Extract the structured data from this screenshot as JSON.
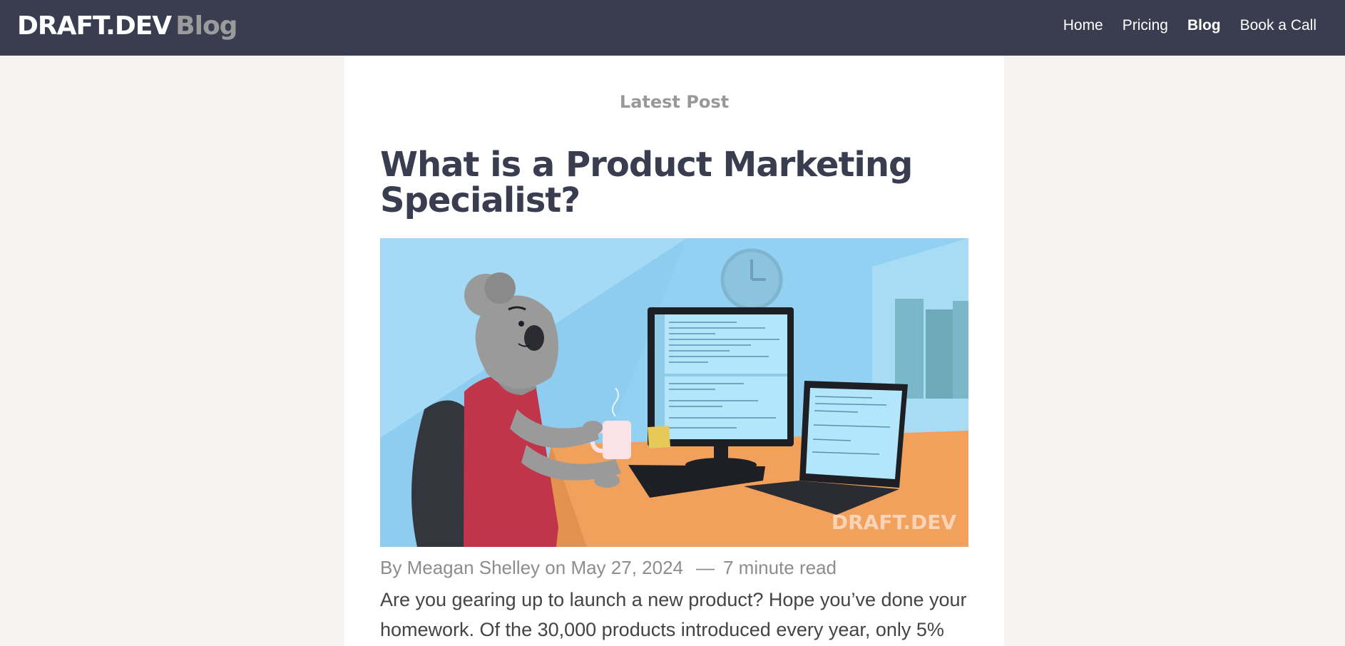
{
  "header": {
    "brand": "DRAFT.DEV",
    "brand_suffix": "Blog",
    "nav": [
      "Home",
      "Pricing",
      "Blog",
      "Book a Call"
    ]
  },
  "post": {
    "eyebrow": "Latest Post",
    "title": "What is a Product Marketing Specialist?",
    "image_watermark": "DRAFT.DEV",
    "byline": {
      "prefix": "By",
      "author": "Meagan Shelley",
      "on": "on",
      "date": "May 27, 2024",
      "separator": "—",
      "read_time": "7 minute read"
    },
    "excerpt": "Are you gearing up to launch a new product? Hope you’ve done your homework. Of the 30,000 products introduced every year, only 5%"
  },
  "colors": {
    "header_bg": "#393d4f",
    "page_bg": "#f4f3ef",
    "title": "#393d4f",
    "muted": "#999999"
  }
}
